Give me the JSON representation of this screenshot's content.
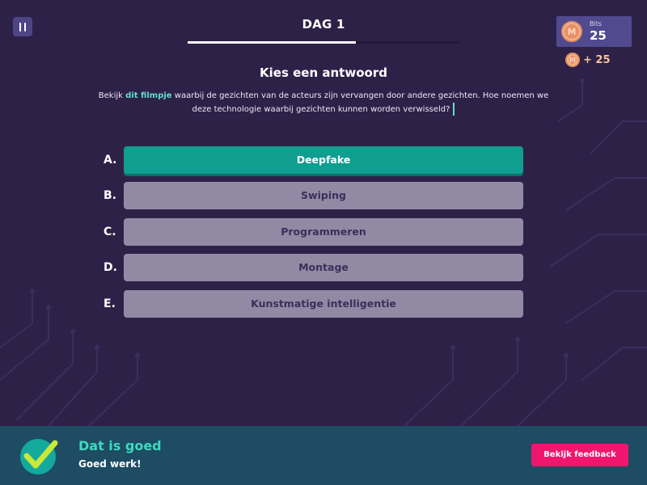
{
  "header": {
    "day_title": "DAG 1",
    "progress_fraction": 0.62
  },
  "wallet": {
    "label": "Bits",
    "value": "25",
    "coin_glyph": "M",
    "reward": "+ 25"
  },
  "question": {
    "title": "Kies een antwoord",
    "text_before": "Bekijk ",
    "link_text": "dit filmpje",
    "text_after": " waarbij de gezichten van de acteurs zijn vervangen door andere gezichten. Hoe noemen we deze technologie waarbij gezichten kunnen worden verwisseld?"
  },
  "answers": [
    {
      "letter": "A.",
      "label": "Deepfake",
      "state": "correct"
    },
    {
      "letter": "B.",
      "label": "Swiping",
      "state": "neutral"
    },
    {
      "letter": "C.",
      "label": "Programmeren",
      "state": "neutral"
    },
    {
      "letter": "D.",
      "label": "Montage",
      "state": "neutral"
    },
    {
      "letter": "E.",
      "label": "Kunstmatige intelligentie",
      "state": "neutral"
    }
  ],
  "feedback": {
    "title": "Dat is goed",
    "subtitle": "Goed werk!",
    "button_label": "Bekijk feedback"
  },
  "icons": {
    "pause": "pause-icon",
    "coin": "coin-icon",
    "check": "checkmark-icon"
  },
  "colors": {
    "background": "#2e2148",
    "correct": "#0f9e90",
    "neutral_answer": "#928aa5",
    "feedback_bar": "#1d4c63",
    "feedback_title": "#3fd9bf",
    "cta": "#f0166d",
    "coin": "#e88f68"
  }
}
